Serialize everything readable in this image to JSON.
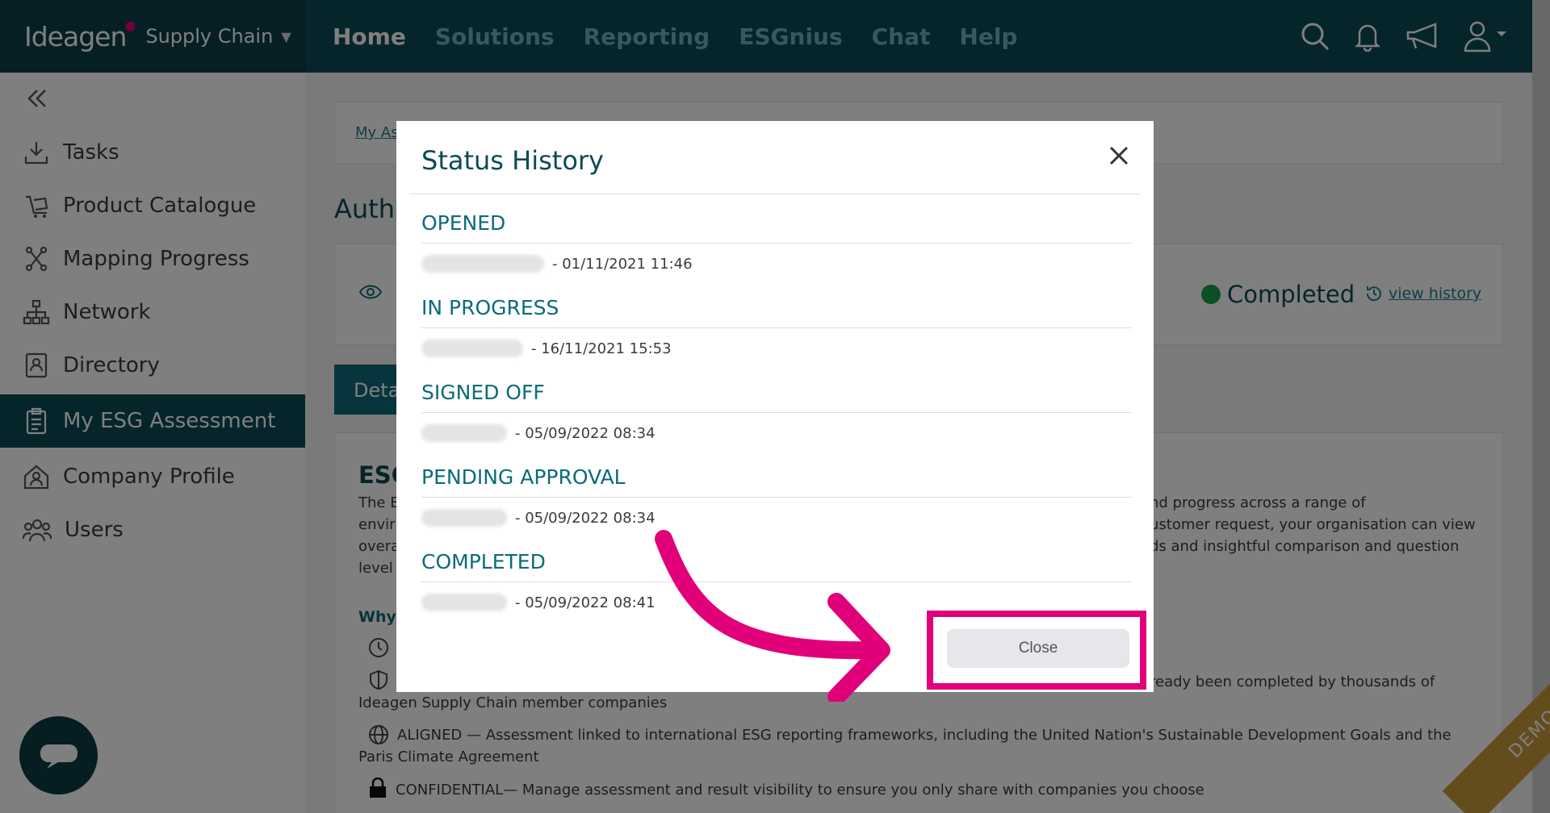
{
  "brand": {
    "logo": "Ideagen",
    "product": "Supply Chain"
  },
  "nav": [
    {
      "label": "Home",
      "active": true
    },
    {
      "label": "Solutions",
      "active": false
    },
    {
      "label": "Reporting",
      "active": false
    },
    {
      "label": "ESGnius",
      "active": false
    },
    {
      "label": "Chat",
      "active": false
    },
    {
      "label": "Help",
      "active": false
    }
  ],
  "sidebar": {
    "items": [
      {
        "label": "Tasks",
        "icon": "tasks-icon"
      },
      {
        "label": "Product Catalogue",
        "icon": "catalogue-icon"
      },
      {
        "label": "Mapping Progress",
        "icon": "mapping-icon"
      },
      {
        "label": "Network",
        "icon": "network-icon"
      },
      {
        "label": "Directory",
        "icon": "directory-icon"
      },
      {
        "label": "My ESG Assessment",
        "icon": "clipboard-icon",
        "active": true
      },
      {
        "label": "Company Profile",
        "icon": "company-icon"
      },
      {
        "label": "Users",
        "icon": "users-icon"
      }
    ]
  },
  "main": {
    "breadcrumb": "My As",
    "heading": "Authe",
    "status": "Completed",
    "view_history": "view history",
    "tab": "Deta",
    "esg_heading": "ESG",
    "para1_left": [
      "The E",
      "envir",
      "overa",
      "level"
    ],
    "para1_right": [
      "nd progress across a range of",
      "ustomer request, your organisation can view",
      "ds and insightful comparison and question"
    ],
    "why": "Why",
    "line_ready": "ready been completed by thousands of",
    "line_members": "Ideagen Supply Chain member companies",
    "line_aligned": "ALIGNED — Assessment linked to international ESG reporting frameworks, including the United Nation's Sustainable Development Goals and the",
    "line_paris": "Paris Climate Agreement",
    "line_confidential": "CONFIDENTIAL— Manage assessment and result visibility to ensure you only share with companies you choose"
  },
  "modal": {
    "title": "Status History",
    "entries": [
      {
        "status": "OPENED",
        "timestamp": "- 01/11/2021 11:46"
      },
      {
        "status": "IN PROGRESS",
        "timestamp": "- 16/11/2021 15:53"
      },
      {
        "status": "SIGNED OFF",
        "timestamp": "- 05/09/2022 08:34"
      },
      {
        "status": "PENDING APPROVAL",
        "timestamp": "- 05/09/2022 08:34"
      },
      {
        "status": "COMPLETED",
        "timestamp": "- 05/09/2022 08:41"
      }
    ],
    "close_label": "Close"
  },
  "demo_ribbon": "DEMO",
  "colors": {
    "brand": "#0c4a56",
    "accent": "#e2007a",
    "success": "#1b9e4b"
  }
}
